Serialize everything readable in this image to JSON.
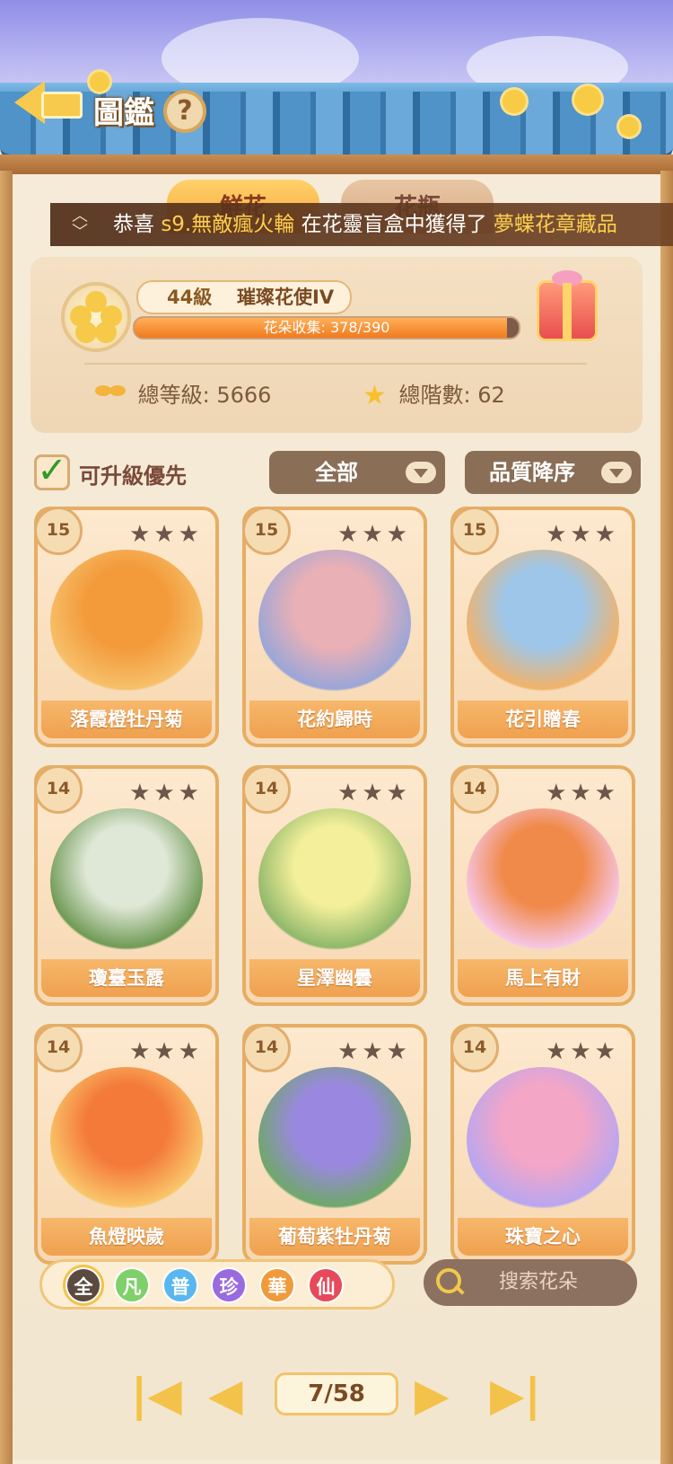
{
  "header": {
    "title": "圖鑑",
    "help_label": "?"
  },
  "tabs": [
    {
      "label": "鮮花",
      "active": true
    },
    {
      "label": "花瓶",
      "active": false
    }
  ],
  "ticker": {
    "prefix": "恭喜",
    "player": "s9.無敵瘋火輪",
    "middle": "在花靈盲盒中獲得了",
    "item": "夢蝶花章藏品"
  },
  "profile": {
    "level": "44級",
    "rank": "璀璨花使IV",
    "progress_text": "花朵收集: 378/390",
    "progress_ratio": 0.969,
    "total_level": "總等級: 5666",
    "total_stars": "總階數: 62"
  },
  "filters": {
    "upgradable_first_label": "可升級優先",
    "upgradable_first_checked": true,
    "category": "全部",
    "sort": "品質降序"
  },
  "cards": [
    {
      "level": "15",
      "name": "落霞橙牡丹菊",
      "colors": [
        "#f39a3a",
        "#f6c06a"
      ]
    },
    {
      "level": "15",
      "name": "花約歸時",
      "colors": [
        "#e9b0b6",
        "#9aa6d8"
      ]
    },
    {
      "level": "15",
      "name": "花引贈春",
      "colors": [
        "#9ec6e8",
        "#f2b36a"
      ]
    },
    {
      "level": "14",
      "name": "瓊臺玉露",
      "colors": [
        "#dfe7d6",
        "#6f9a55"
      ]
    },
    {
      "level": "14",
      "name": "星澤幽曇",
      "colors": [
        "#f3ef9a",
        "#8fb86a"
      ]
    },
    {
      "level": "14",
      "name": "馬上有財",
      "colors": [
        "#f08a4a",
        "#f6c6e6"
      ]
    },
    {
      "level": "14",
      "name": "魚燈映歲",
      "colors": [
        "#f47a3a",
        "#f9c66a"
      ]
    },
    {
      "level": "14",
      "name": "葡萄紫牡丹菊",
      "colors": [
        "#9a88e0",
        "#6fa86a"
      ]
    },
    {
      "level": "14",
      "name": "珠寶之心",
      "colors": [
        "#f3a6c6",
        "#b9a6f0"
      ]
    }
  ],
  "rarity_filters": [
    {
      "label": "全",
      "color": "#5a4a40",
      "selected": true
    },
    {
      "label": "凡",
      "color": "#7fd06a",
      "selected": false
    },
    {
      "label": "普",
      "color": "#5ab6ef",
      "selected": false
    },
    {
      "label": "珍",
      "color": "#9a6adf",
      "selected": false
    },
    {
      "label": "華",
      "color": "#f09a3a",
      "selected": false
    },
    {
      "label": "仙",
      "color": "#e64a5a",
      "selected": false
    }
  ],
  "search": {
    "placeholder": "搜索花朵"
  },
  "pagination": {
    "current": "7/58"
  }
}
